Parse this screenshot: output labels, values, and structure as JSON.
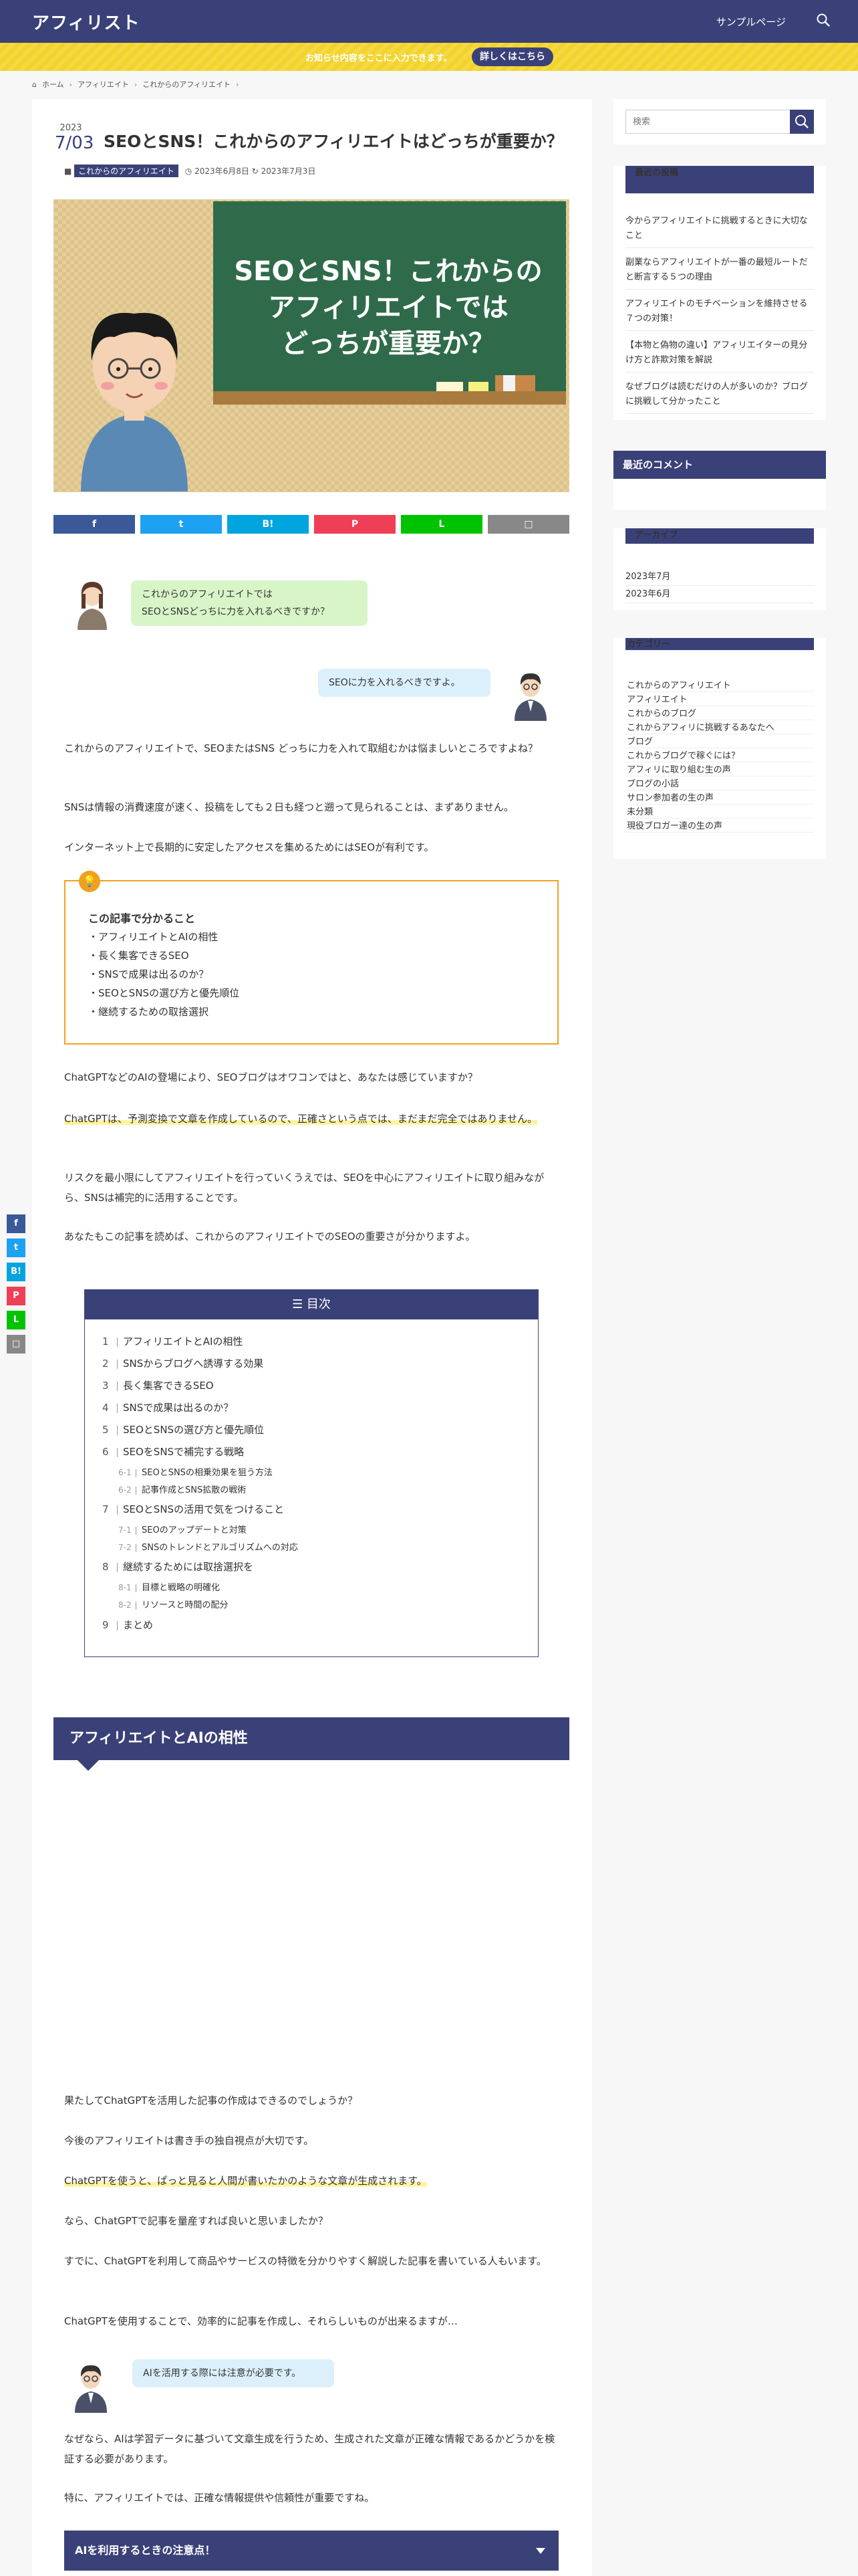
{
  "header": {
    "logo": "アフィリスト",
    "nav": "サンプルページ",
    "search_icon": "search-icon"
  },
  "notice": {
    "text": "お知らせ内容をここに入力できます。",
    "button": "詳しくはこちら",
    "color": "#f2d32a"
  },
  "breadcrumb": {
    "home": "ホーム",
    "cat1": "アフィリエイト",
    "cat2": "これからのアフィリエイト"
  },
  "article": {
    "year": "2023",
    "monthday": "7/03",
    "title": "SEOとSNS！これからのアフィリエイトはどっちが重要か？",
    "category": "これからのアフィリエイト",
    "published": "2023年6月8日",
    "updated": "2023年7月3日",
    "eyecatch_lines": [
      "SEOとSNS！これからの",
      "アフィリエイトでは",
      "どっちが重要か？"
    ]
  },
  "share": [
    {
      "icon": "f",
      "name": "facebook",
      "color": "#3b5998"
    },
    {
      "icon": "t",
      "name": "twitter",
      "color": "#1da1f2"
    },
    {
      "icon": "B!",
      "name": "hatena",
      "color": "#00a4de"
    },
    {
      "icon": "P",
      "name": "pocket",
      "color": "#ef3f56"
    },
    {
      "icon": "L",
      "name": "line",
      "color": "#00c300"
    },
    {
      "icon": "□",
      "name": "copy",
      "color": "#888888"
    }
  ],
  "bubbles": {
    "q1": [
      "これからのアフィリエイトでは",
      "SEOとSNSどっちに力を入れるべきですか？"
    ],
    "a1": "SEOに力を入れるべきですよ。",
    "warn": "AIを活用する際には注意が必要です。"
  },
  "paragraphs": {
    "p1": "これからのアフィリエイトで、SEOまたはSNS どっちに力を入れて取組むかは悩ましいところですよね？",
    "p2": "SNSは情報の消費速度が速く、投稿をしても２日も経つと遡って見られることは、まずありません。",
    "p3": "インターネット上で長期的に安定したアクセスを集めるためにはSEOが有利です。",
    "p4": "ChatGPTなどのAIの登場により、SEOブログはオワコンではと、あなたは感じていますか？",
    "p5": "ChatGPTは、予測変換で文章を作成しているので、正確さという点では、まだまだ完全ではありません。",
    "p6": "リスクを最小限にしてアフィリエイトを行っていくうえでは、SEOを中心にアフィリエイトに取り組みながら、SNSは補完的に活用することです。",
    "p7": "あなたもこの記事を読めば、これからのアフィリエイトでのSEOの重要さが分かりますよ。",
    "p8": "果たしてChatGPTを活用した記事の作成はできるのでしょうか？",
    "p9": "今後のアフィリエイトは書き手の独自視点が大切です。",
    "p10": "ChatGPTを使うと、ぱっと見ると人間が書いたかのような文章が生成されます。",
    "p11": "なら、ChatGPTで記事を量産すれば良いと思いましたか？",
    "p12": "すでに、ChatGPTを利用して商品やサービスの特徴を分かりやすく解説した記事を書いている人もいます。",
    "p13": "ChatGPTを使用することで、効率的に記事を作成し、それらしいものが出来るますが…",
    "p14": "なぜなら、AIは学習データに基づいて文章生成を行うため、生成された文章が正確な情報であるかどうかを検証する必要があります。",
    "p15": "特に、アフィリエイトでは、正確な情報提供や信頼性が重要ですね。"
  },
  "point_box": {
    "title": "この記事で分かること",
    "items": [
      "・アフィリエイトとAIの相性",
      "・長く集客できるSEO",
      "・SNSで成果は出るのか？",
      "・SEOとSNSの選び方と優先順位",
      "・継続するための取捨選択"
    ]
  },
  "toc": {
    "title": "目次",
    "items": [
      {
        "n": "1",
        "t": "アフィリエイトとAIの相性"
      },
      {
        "n": "2",
        "t": "SNSからブログへ誘導する効果"
      },
      {
        "n": "3",
        "t": "長く集客できるSEO"
      },
      {
        "n": "4",
        "t": "SNSで成果は出るのか？"
      },
      {
        "n": "5",
        "t": "SEOとSNSの選び方と優先順位"
      },
      {
        "n": "6",
        "t": "SEOをSNSで補完する戦略"
      },
      {
        "n": "6-1",
        "t": "SEOとSNSの相乗効果を狙う方法"
      },
      {
        "n": "6-2",
        "t": "記事作成とSNS拡散の戦術"
      },
      {
        "n": "7",
        "t": "SEOとSNSの活用で気をつけること"
      },
      {
        "n": "7-1",
        "t": "SEOのアップデートと対策"
      },
      {
        "n": "7-2",
        "t": "SNSのトレンドとアルゴリズムへの対応"
      },
      {
        "n": "8",
        "t": "継続するためには取捨選択を"
      },
      {
        "n": "8-1",
        "t": "目標と戦略の明確化"
      },
      {
        "n": "8-2",
        "t": "リソースと時間の配分"
      },
      {
        "n": "9",
        "t": "まとめ"
      }
    ]
  },
  "h2": "アフィリエイトとAIの相性",
  "accordion": "AIを利用するときの注意点！",
  "sidebar": {
    "search_placeholder": "検索",
    "recent_title": "最近の投稿",
    "recent": [
      "今からアフィリエイトに挑戦するときに大切なこと",
      "副業ならアフィリエイトが一番の最短ルートだと断言する５つの理由",
      "アフィリエイトのモチベーションを維持させる７つの対策！",
      "【本物と偽物の違い】アフィリエイターの見分け方と詐欺対策を解説",
      "なぜブログは読むだけの人が多いのか？ブログに挑戦して分かったこと"
    ],
    "comments_title": "最近のコメント",
    "archive_title": "アーカイブ",
    "archives": [
      "2023年7月",
      "2023年6月"
    ],
    "category_title": "カテゴリー",
    "categories": [
      "これからのアフィリエイト",
      "アフィリエイト",
      "これからのブログ",
      "これからアフィリに挑戦するあなたへ",
      "ブログ",
      "これからブログで稼ぐには？",
      "アフィリに取り組む生の声",
      "ブログの小話",
      "サロン参加者の生の声",
      "未分類",
      "現役ブロガー達の生の声"
    ]
  },
  "colors": {
    "brand": "#3a4178",
    "accent": "#f0a020",
    "highlight": "#fff3a0"
  }
}
